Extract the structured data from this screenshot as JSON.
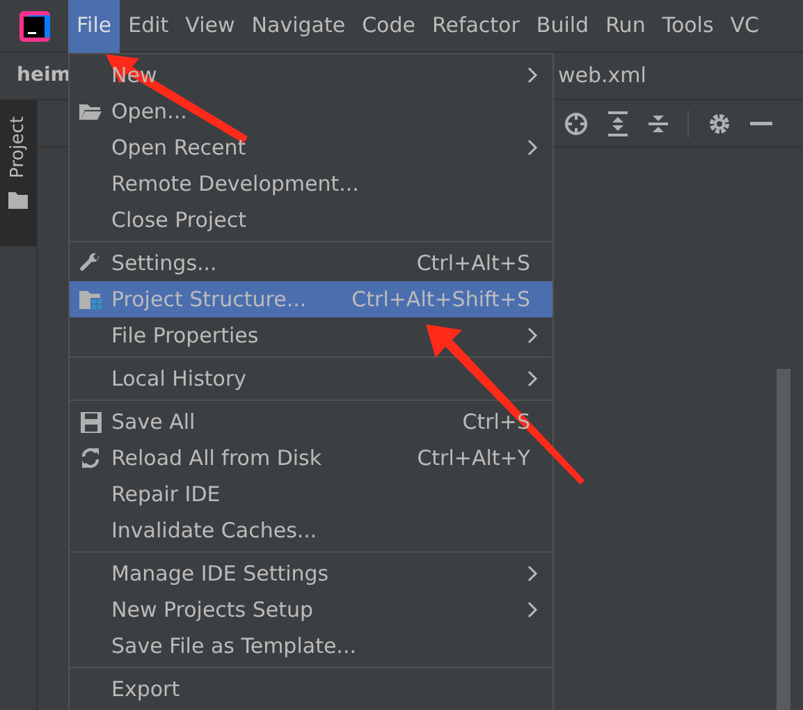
{
  "menu_bar": [
    {
      "label": "File",
      "selected": true
    },
    {
      "label": "Edit",
      "selected": false
    },
    {
      "label": "View",
      "selected": false
    },
    {
      "label": "Navigate",
      "selected": false
    },
    {
      "label": "Code",
      "selected": false
    },
    {
      "label": "Refactor",
      "selected": false
    },
    {
      "label": "Build",
      "selected": false
    },
    {
      "label": "Run",
      "selected": false
    },
    {
      "label": "Tools",
      "selected": false
    },
    {
      "label": "VC",
      "selected": false
    }
  ],
  "navigation_bar": {
    "project": "heim",
    "file_tab": "web.xml"
  },
  "tool_window": {
    "label": "Project"
  },
  "file_menu": [
    {
      "kind": "plain",
      "label": "New",
      "submenu": true,
      "selected": false
    },
    {
      "kind": "open",
      "label": "Open...",
      "selected": false
    },
    {
      "kind": "plain",
      "label": "Open Recent",
      "submenu": true,
      "selected": false
    },
    {
      "kind": "plain",
      "label": "Remote Development...",
      "selected": false
    },
    {
      "kind": "plain",
      "label": "Close Project",
      "selected": false
    },
    {
      "kind": "separator"
    },
    {
      "kind": "settings",
      "label": "Settings...",
      "shortcut": "Ctrl+Alt+S",
      "selected": false
    },
    {
      "kind": "structure",
      "label": "Project Structure...",
      "shortcut": "Ctrl+Alt+Shift+S",
      "selected": true
    },
    {
      "kind": "plain",
      "label": "File Properties",
      "submenu": true,
      "selected": false
    },
    {
      "kind": "separator"
    },
    {
      "kind": "plain",
      "label": "Local History",
      "submenu": true,
      "selected": false
    },
    {
      "kind": "separator"
    },
    {
      "kind": "save",
      "label": "Save All",
      "shortcut": "Ctrl+S",
      "selected": false
    },
    {
      "kind": "reload",
      "label": "Reload All from Disk",
      "shortcut": "Ctrl+Alt+Y",
      "selected": false
    },
    {
      "kind": "plain",
      "label": "Repair IDE",
      "selected": false
    },
    {
      "kind": "plain",
      "label": "Invalidate Caches...",
      "selected": false
    },
    {
      "kind": "separator"
    },
    {
      "kind": "plain",
      "label": "Manage IDE Settings",
      "submenu": true,
      "selected": false
    },
    {
      "kind": "plain",
      "label": "New Projects Setup",
      "submenu": true,
      "selected": false
    },
    {
      "kind": "plain",
      "label": "Save File as Template...",
      "selected": false
    },
    {
      "kind": "separator"
    },
    {
      "kind": "plain",
      "label": "Export",
      "selected": false
    }
  ]
}
